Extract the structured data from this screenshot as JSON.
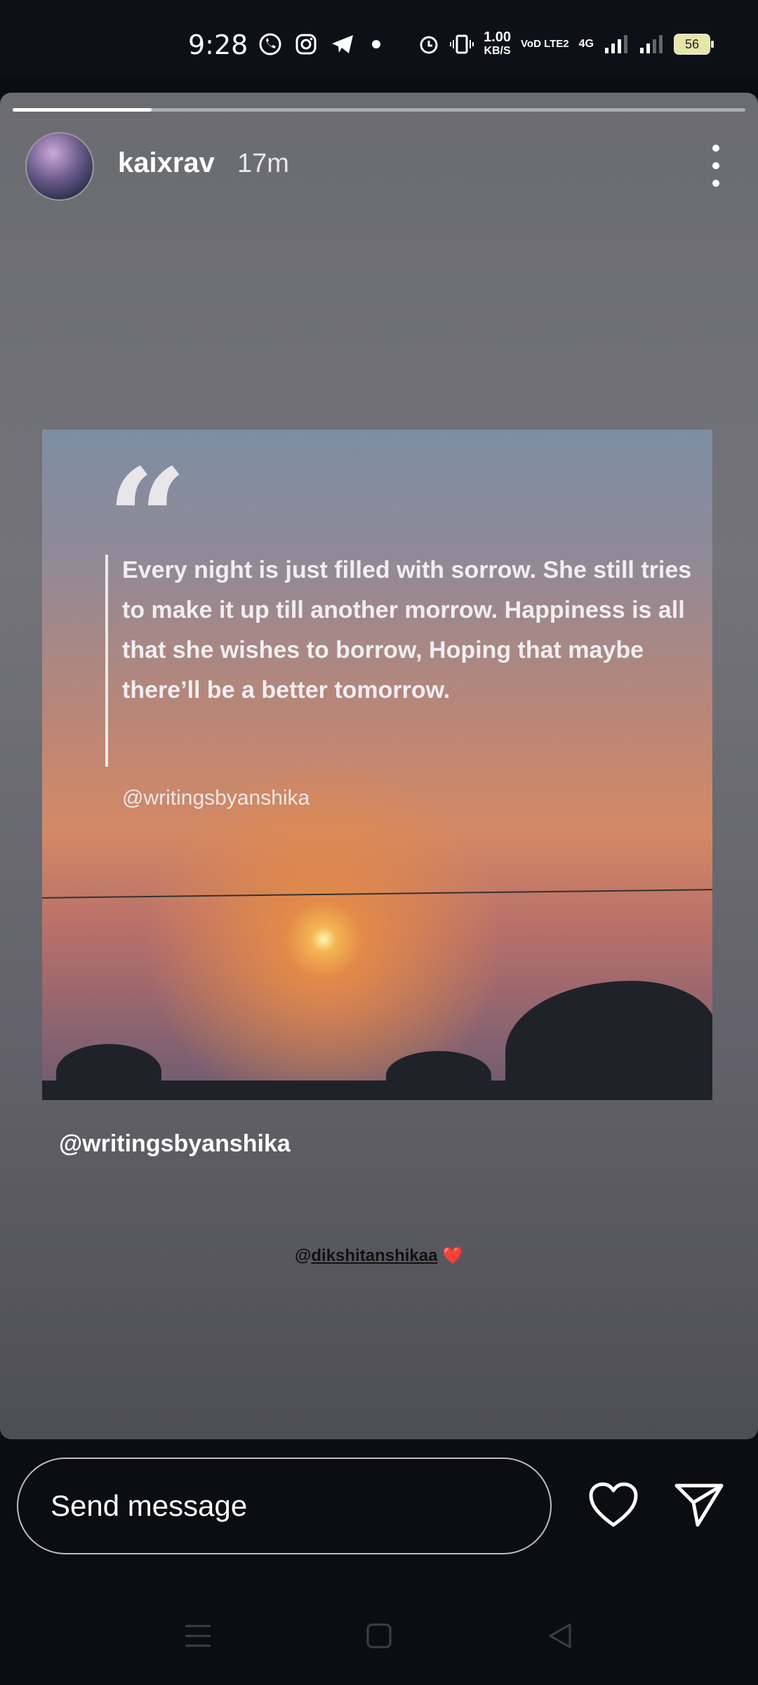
{
  "status_bar": {
    "time": "9:28",
    "network_speed": "1.00",
    "network_speed_unit": "KB/S",
    "carrier": "VoD LTE2",
    "network_type": "4G",
    "battery": "56"
  },
  "story": {
    "progress": 0.19,
    "username": "kaixrav",
    "time_ago": "17m",
    "image": {
      "quote_mark": "“",
      "quote_text": "Every night is just filled with sorrow. She still tries to make it up till another morrow. Happiness is all that she wishes to borrow, Hoping that maybe there’ll be a better tomorrow.",
      "handle": "@writingsbyanshika"
    },
    "mention_primary": "@writingsbyanshika",
    "mention_secondary_prefix": "@",
    "mention_secondary": "dikshitanshikaa",
    "mention_secondary_emoji": "❤️"
  },
  "reply_bar": {
    "placeholder": "Send message"
  },
  "icons": {
    "more": "more-vertical-icon",
    "like": "heart-outline-icon",
    "send": "send-icon"
  }
}
